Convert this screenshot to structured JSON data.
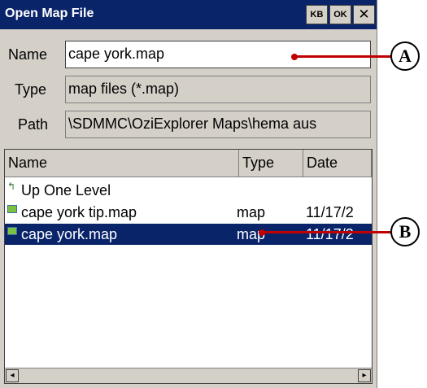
{
  "window": {
    "title": "Open Map File",
    "kb_label": "KB",
    "ok_label": "OK",
    "close_glyph": "✕"
  },
  "form": {
    "name_label": "Name",
    "name_value": "cape york.map",
    "type_label": "Type",
    "type_value": "map files (*.map)",
    "path_label": "Path",
    "path_value": "\\SDMMC\\OziExplorer Maps\\hema aus"
  },
  "list": {
    "columns": [
      "Name",
      "Type",
      "Date"
    ],
    "rows": [
      {
        "icon": "up-folder-icon",
        "name": "Up One Level",
        "type": "",
        "date": "",
        "selected": false
      },
      {
        "icon": "map-file-icon",
        "name": "cape york tip.map",
        "type": "map",
        "date": "11/17/2",
        "selected": false
      },
      {
        "icon": "map-file-icon",
        "name": "cape york.map",
        "type": "map",
        "date": "11/17/2",
        "selected": true
      }
    ],
    "scroll_left": "◂",
    "scroll_right": "▸"
  },
  "annotations": {
    "a": "A",
    "b": "B"
  },
  "colors": {
    "titlebar": "#0a246a",
    "selection": "#0a246a",
    "callout_line": "#c00000"
  }
}
